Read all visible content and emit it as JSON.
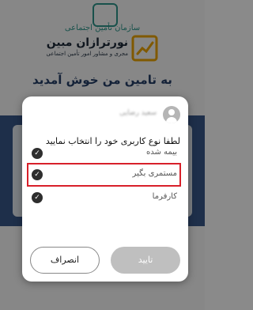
{
  "background": {
    "org_name": "سازمان تأمین اجتماعی",
    "brand_name": "نورترازان مبین",
    "brand_subtitle": "مجری و مشاور امور تأمین اجتماعی",
    "welcome": "به تامین من خوش آمدید"
  },
  "dialog": {
    "user_name": "سعید رضایی",
    "prompt": "لطفا نوع کاربری خود را انتخاب نمایید",
    "options": [
      {
        "label": "بیمه شده",
        "checked": true
      },
      {
        "label": "مستمری بگیر",
        "checked": true,
        "highlighted": true
      },
      {
        "label": "کارفرما",
        "checked": true
      }
    ],
    "confirm_label": "تایید",
    "cancel_label": "انصراف"
  },
  "colors": {
    "highlight_border": "#d8202a",
    "teal": "#2f9a8f",
    "confirm_disabled": "#bfbfbf"
  }
}
